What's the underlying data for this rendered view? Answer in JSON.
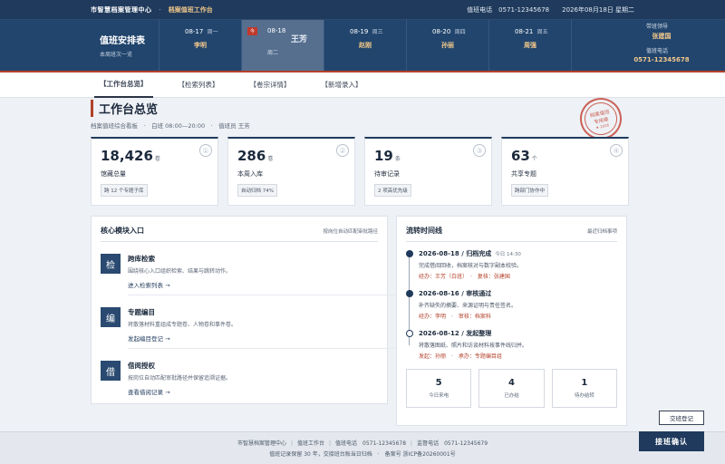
{
  "topbar": {
    "brand": "市智慧档案管理中心",
    "sep": "·",
    "module": "档案值班工作台",
    "phone": "值班电话　0571-12345678",
    "date": "2026年08月18日 星期二"
  },
  "schedule": {
    "title": "值班安排表",
    "subtitle": "本周班次一览",
    "days": [
      {
        "date": "08-17",
        "weekday": "周一",
        "person": "李明"
      },
      {
        "date": "08-18",
        "weekday": "周二",
        "person": "王芳",
        "badge": "今"
      },
      {
        "date": "08-19",
        "weekday": "周三",
        "person": "赵刚"
      },
      {
        "date": "08-20",
        "weekday": "周四",
        "person": "孙丽"
      },
      {
        "date": "08-21",
        "weekday": "周五",
        "person": "周强"
      }
    ],
    "leader_label": "带班领导",
    "leader_name": "张建国",
    "phone_label": "值班电话",
    "phone": "0571-12345678"
  },
  "tabs": [
    "【工作台总览】",
    "【检索列表】",
    "【卷宗详情】",
    "【新增录入】"
  ],
  "page": {
    "title": "工作台总览",
    "subtitle": "档案值班综合看板　·　白班 08:00—20:00　·　值班员 王芳"
  },
  "seal": {
    "line1": "档案值班",
    "line2": "专用章",
    "line3": "★ 2026"
  },
  "stats": [
    {
      "num": "18,426",
      "unit": "卷",
      "label": "馆藏总量",
      "tag": "跨 12 个专题子库",
      "idx": "①"
    },
    {
      "num": "286",
      "unit": "卷",
      "label": "本周入库",
      "tag": "自动归档 74%",
      "idx": "②"
    },
    {
      "num": "19",
      "unit": "条",
      "label": "待审记录",
      "tag": "2 项高优先级",
      "idx": "③"
    },
    {
      "num": "63",
      "unit": "个",
      "label": "共享专题",
      "tag": "跨部门协作中",
      "idx": "④"
    }
  ],
  "core": {
    "heading": "核心模块入口",
    "note": "按岗位自动匹配审批路径",
    "modules": [
      {
        "icon": "检",
        "name": "跨库检索",
        "desc": "围绕核心入口组织检索、结果与跳转动作。",
        "link": "进入检索列表 →"
      },
      {
        "icon": "编",
        "name": "专题编目",
        "desc": "将散落材料重组成专题卷、人物卷和事件卷。",
        "link": "发起编目登记 →"
      },
      {
        "icon": "借",
        "name": "借阅授权",
        "desc": "按岗位自动匹配审批路径并保留追溯证据。",
        "link": "查看借阅记录 →"
      }
    ]
  },
  "timeline": {
    "heading": "流转时间线",
    "note": "最近归档事项",
    "items": [
      {
        "title": "2026-08-18 / 归档完成",
        "time": "今日 14:30",
        "desc": "完成借阅回收，档案核对与数字副本校验。",
        "who": "经办：王芳（白班）　·　复核：张建国",
        "hollow": false
      },
      {
        "title": "2026-08-16 / 审核通过",
        "time": "",
        "desc": "补齐缺失的摘要、来源证明与责任签名。",
        "who": "经办：李明　·　审核：档案科",
        "hollow": false
      },
      {
        "title": "2026-08-12 / 发起整理",
        "time": "",
        "desc": "将散落图纸、照片和访谈材料按事件线归并。",
        "who": "发起：孙丽　·　承办：专题编目组",
        "hollow": true
      }
    ],
    "stats": [
      {
        "n": "5",
        "l": "今日来电"
      },
      {
        "n": "4",
        "l": "已办结"
      },
      {
        "n": "1",
        "l": "待办结转"
      }
    ]
  },
  "footer": {
    "line1_a": "市智慧档案管理中心",
    "line1_b": "值班工作台",
    "line1_c": "值班电话　0571-12345678",
    "line1_d": "监督电话　0571-12345679",
    "line2": "值班记录保留 30 年，交接班台账当日归档　·　备案号 浙ICP备20260001号"
  },
  "buttons": {
    "log": "交班登记",
    "confirm": "接班确认"
  }
}
